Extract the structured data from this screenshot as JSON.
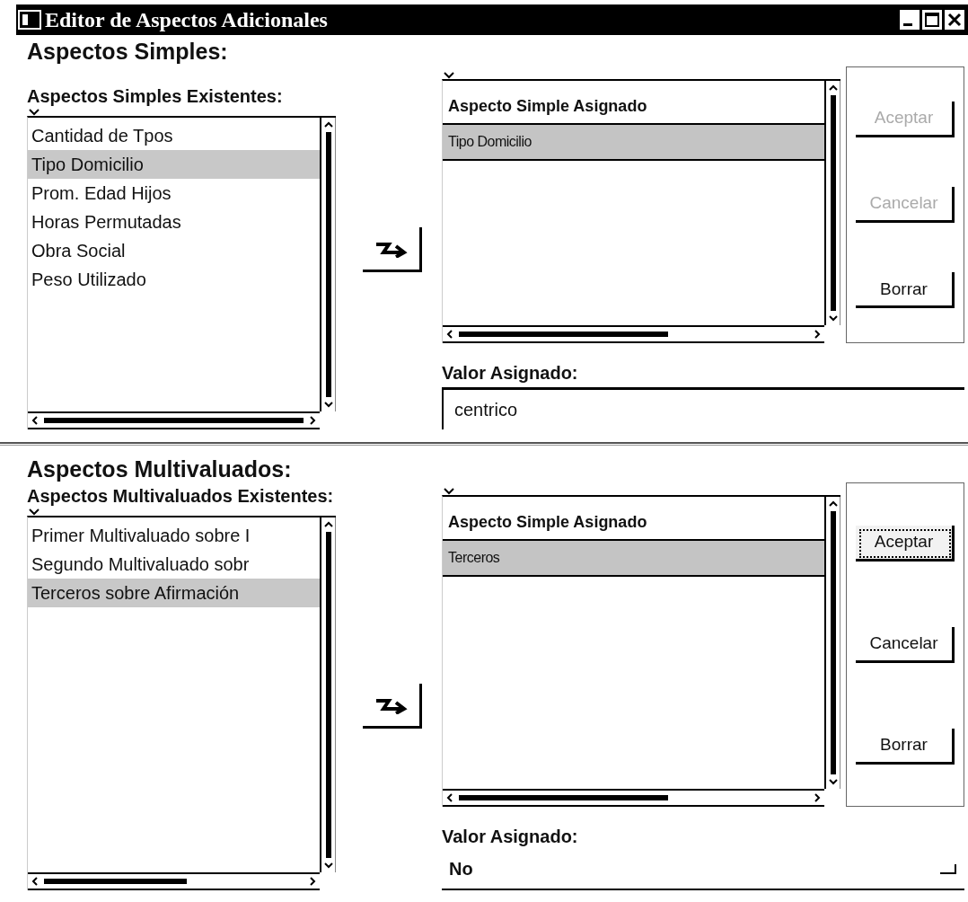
{
  "window": {
    "title": "Editor de Aspectos Adicionales"
  },
  "sections": [
    {
      "heading": "Aspectos Simples:",
      "existing_label": "Aspectos Simples Existentes:",
      "existing_items": [
        {
          "label": "Cantidad de Tpos",
          "selected": false
        },
        {
          "label": "Tipo Domicilio",
          "selected": true
        },
        {
          "label": "Prom. Edad Hijos",
          "selected": false
        },
        {
          "label": "Horas Permutadas",
          "selected": false
        },
        {
          "label": "Obra Social",
          "selected": false
        },
        {
          "label": "Peso Utilizado",
          "selected": false
        }
      ],
      "assigned_header": "Aspecto Simple Asignado",
      "assigned_rows": [
        {
          "label": "Tipo Domicilio",
          "selected": true
        }
      ],
      "buttons": [
        {
          "label": "Aceptar",
          "disabled": true,
          "focused": false
        },
        {
          "label": "Cancelar",
          "disabled": true,
          "focused": false
        },
        {
          "label": "Borrar",
          "disabled": false,
          "focused": false
        }
      ],
      "value_label": "Valor Asignado:",
      "value": {
        "kind": "text",
        "value": "centrico"
      }
    },
    {
      "heading": "Aspectos Multivaluados:",
      "existing_label": "Aspectos Multivaluados Existentes:",
      "existing_items": [
        {
          "label": "Primer Multivaluado sobre I",
          "selected": false
        },
        {
          "label": "Segundo Multivaluado sobr",
          "selected": false
        },
        {
          "label": "Terceros sobre Afirmación",
          "selected": true
        }
      ],
      "assigned_header": "Aspecto Simple Asignado",
      "assigned_rows": [
        {
          "label": "Terceros",
          "selected": true
        }
      ],
      "buttons": [
        {
          "label": "Aceptar",
          "disabled": false,
          "focused": true
        },
        {
          "label": "Cancelar",
          "disabled": false,
          "focused": false
        },
        {
          "label": "Borrar",
          "disabled": false,
          "focused": false
        }
      ],
      "value_label": "Valor Asignado:",
      "value": {
        "kind": "dropdown",
        "value": "No"
      }
    }
  ]
}
